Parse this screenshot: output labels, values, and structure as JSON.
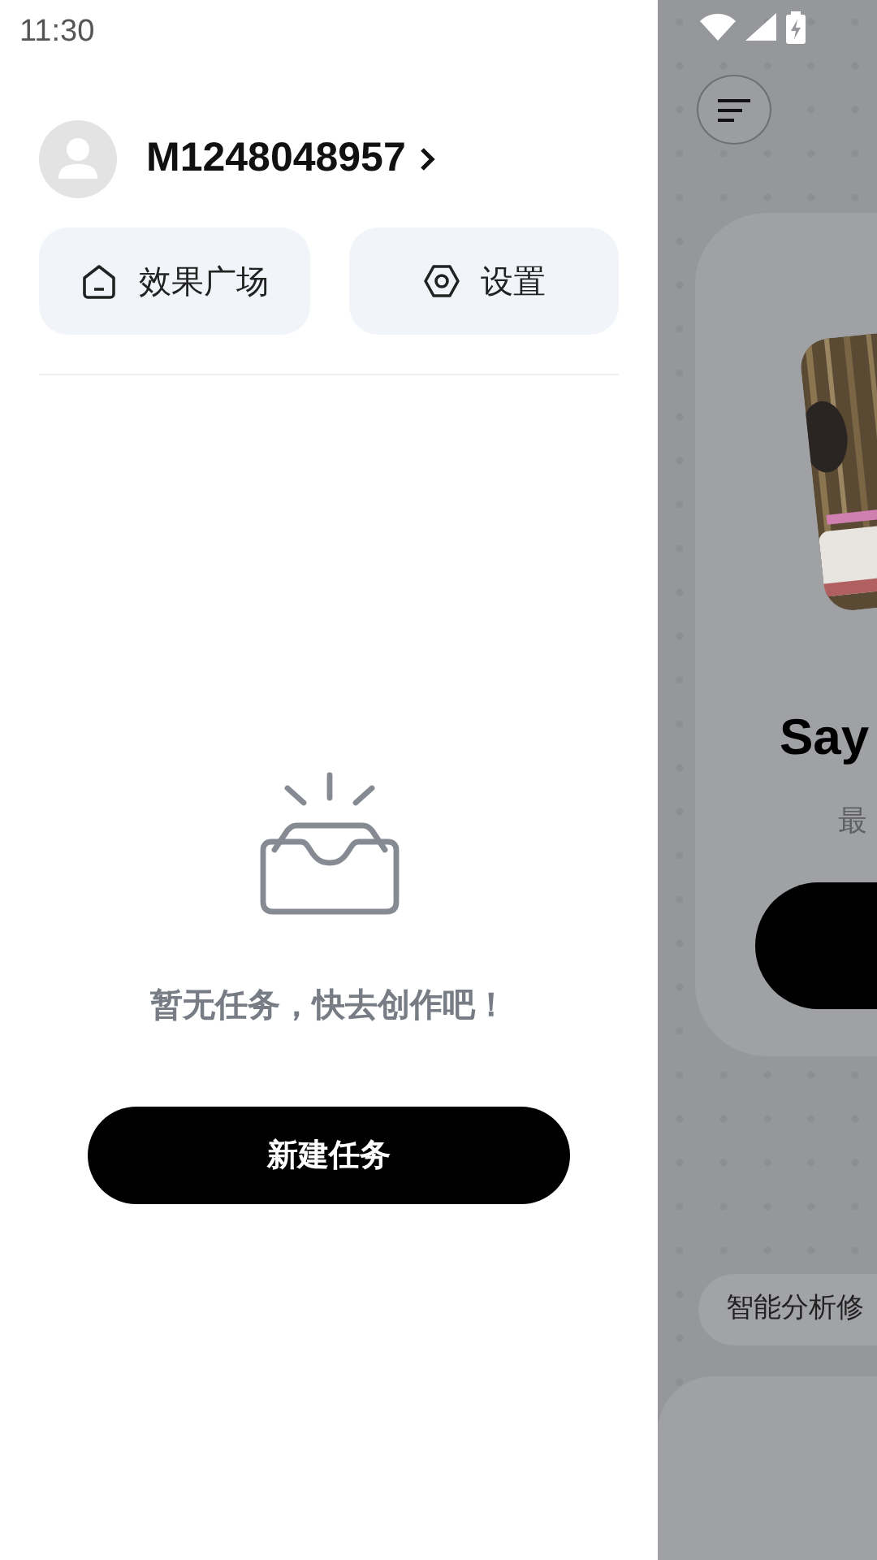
{
  "status_bar": {
    "time": "11:30"
  },
  "user": {
    "name": "M1248048957"
  },
  "actions": [
    {
      "label": "效果广场",
      "kind": "home"
    },
    {
      "label": "设置",
      "kind": "settings"
    }
  ],
  "empty_state": {
    "message": "暂无任务，快去创作吧！"
  },
  "new_task_button": {
    "label": "新建任务"
  },
  "background": {
    "title": "Say",
    "subtitle": "最",
    "chip": "智能分析修"
  }
}
